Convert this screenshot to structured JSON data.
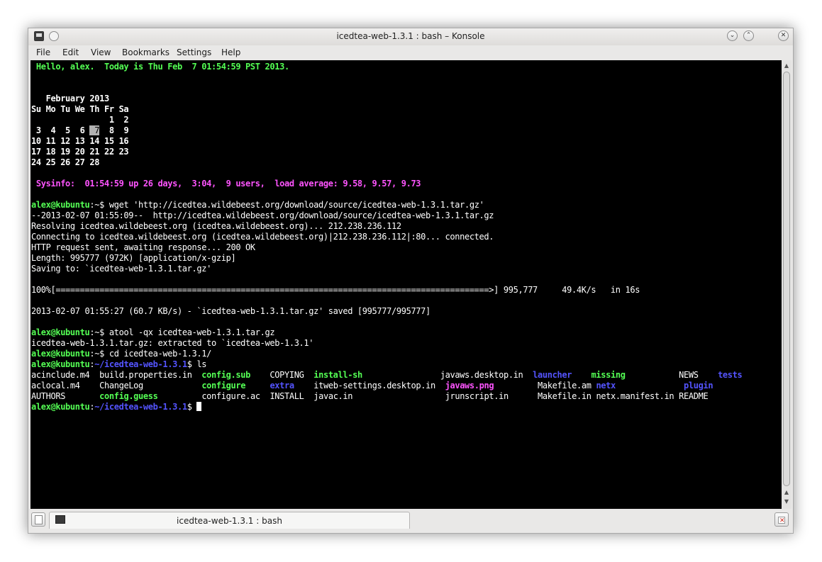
{
  "window": {
    "title": "icedtea-web-1.3.1 : bash – Konsole",
    "controls": {
      "minimize": "⌄",
      "maximize": "⌃",
      "close": "✕"
    }
  },
  "menu": [
    "File",
    "Edit",
    "View",
    "Bookmarks",
    "Settings",
    "Help"
  ],
  "terminal": {
    "greeting": " Hello, alex.  Today is Thu Feb  7 01:54:59 PST 2013.",
    "calendar": {
      "month": "   February 2013",
      "days": "Su Mo Tu We Th Fr Sa",
      "week1": "                1  2",
      "week2_a": " 3  4  5  6 ",
      "today": " 7",
      "week2_b": "  8  9",
      "week3": "10 11 12 13 14 15 16",
      "week4": "17 18 19 20 21 22 23",
      "week5": "24 25 26 27 28"
    },
    "sysinfo": " Sysinfo:  01:54:59 up 26 days,  3:04,  9 users,  load average: 9.58, 9.57, 9.73",
    "prompt_user": "alex@kubuntu",
    "prompt_home": ":~$ ",
    "prompt_colon": ":",
    "prompt_dir": "~/icedtea-web-1.3.1",
    "prompt_dollar": "$ ",
    "cmd1": "wget 'http://icedtea.wildebeest.org/download/source/icedtea-web-1.3.1.tar.gz'",
    "wget_lines": [
      "--2013-02-07 01:55:09--  http://icedtea.wildebeest.org/download/source/icedtea-web-1.3.1.tar.gz",
      "Resolving icedtea.wildebeest.org (icedtea.wildebeest.org)... 212.238.236.112",
      "Connecting to icedtea.wildebeest.org (icedtea.wildebeest.org)|212.238.236.112|:80... connected.",
      "HTTP request sent, awaiting response... 200 OK",
      "Length: 995777 (972K) [application/x-gzip]",
      "Saving to: `icedtea-web-1.3.1.tar.gz'"
    ],
    "progress": "100%[=========================================================================================>] 995,777     49.4K/s   in 16s",
    "saved": "2013-02-07 01:55:27 (60.7 KB/s) - `icedtea-web-1.3.1.tar.gz' saved [995777/995777]",
    "cmd2": "atool -qx icedtea-web-1.3.1.tar.gz",
    "atool_out": "icedtea-web-1.3.1.tar.gz: extracted to `icedtea-web-1.3.1'",
    "cmd3": "cd icedtea-web-1.3.1/",
    "cmd4": "ls",
    "ls": {
      "acinclude": "acinclude.m4",
      "build_properties": "build.properties.in",
      "config_sub": "config.sub",
      "copying": "COPYING",
      "install_sh": "install-sh",
      "javaws_desktop": "javaws.desktop.in",
      "launcher": "launcher",
      "missing": "missing",
      "news": "NEWS",
      "tests": "tests",
      "aclocal": "aclocal.m4",
      "changelog": "ChangeLog",
      "configure": "configure",
      "extra": "extra",
      "itweb_settings": "itweb-settings.desktop.in",
      "javaws_png": "javaws.png",
      "makefile_am": "Makefile.am",
      "netx": "netx",
      "plugin": "plugin",
      "authors": "AUTHORS",
      "config_guess": "config.guess",
      "configure_ac": "configure.ac",
      "install": "INSTALL",
      "javac": "javac.in",
      "jrunscript": "jrunscript.in",
      "makefile_in": "Makefile.in",
      "netx_manifest": "netx.manifest.in",
      "readme": "README"
    },
    "colors": {
      "bg": "#000000",
      "fg": "#ffffff",
      "green": "#54ff54",
      "magenta": "#ff54ff",
      "blue": "#5454ff"
    }
  },
  "tabbar": {
    "tab_label": "icedtea-web-1.3.1 : bash"
  },
  "icons": [
    "konsole-app-icon",
    "pin-icon",
    "minimize-icon",
    "maximize-icon",
    "close-icon",
    "new-tab-icon",
    "terminal-tab-icon",
    "close-tab-icon"
  ]
}
